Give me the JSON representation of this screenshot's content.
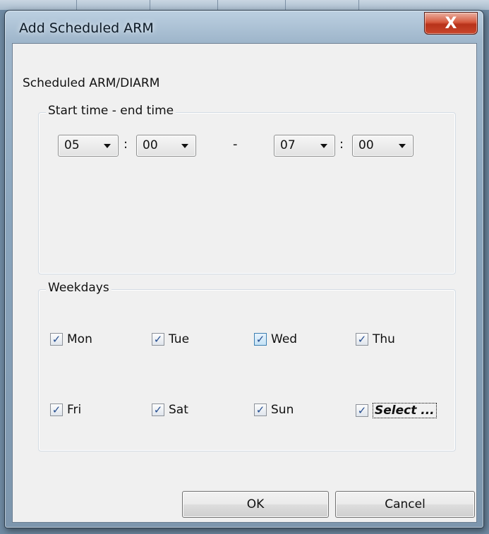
{
  "window": {
    "title": "Add Scheduled ARM",
    "close_glyph": "X"
  },
  "heading": "Scheduled  ARM/DIARM",
  "time_group": {
    "legend": "Start time - end time",
    "start_hour": "05",
    "start_minute": "00",
    "end_hour": "07",
    "end_minute": "00",
    "colon": ":",
    "dash": "-"
  },
  "weekdays_group": {
    "legend": "Weekdays",
    "days": [
      {
        "label": "Mon",
        "checked": true
      },
      {
        "label": "Tue",
        "checked": true
      },
      {
        "label": "Wed",
        "checked": true
      },
      {
        "label": "Thu",
        "checked": true
      },
      {
        "label": "Fri",
        "checked": true
      },
      {
        "label": "Sat",
        "checked": true
      },
      {
        "label": "Sun",
        "checked": true
      },
      {
        "label": "Select ...",
        "checked": true
      }
    ]
  },
  "buttons": {
    "ok": "OK",
    "cancel": "Cancel"
  },
  "icons": {
    "check": "check-icon",
    "dropdown": "chevron-down-icon",
    "close": "close-icon"
  }
}
